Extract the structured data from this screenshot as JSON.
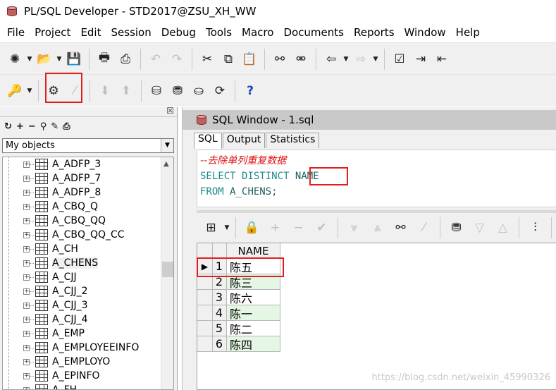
{
  "window": {
    "title": "PL/SQL Developer - STD2017@ZSU_XH_WW"
  },
  "menu": [
    "File",
    "Project",
    "Edit",
    "Session",
    "Debug",
    "Tools",
    "Macro",
    "Documents",
    "Reports",
    "Window",
    "Help"
  ],
  "object_browser": {
    "filter_value": "My objects",
    "tools": [
      "↻",
      "+",
      "−",
      "⚲",
      "✎",
      "⎙"
    ],
    "items": [
      "A_ADFP_3",
      "A_ADFP_7",
      "A_ADFP_8",
      "A_CBQ_Q",
      "A_CBQ_QQ",
      "A_CBQ_QQ_CC",
      "A_CH",
      "A_CHENS",
      "A_CJJ",
      "A_CJJ_2",
      "A_CJJ_3",
      "A_CJJ_4",
      "A_EMP",
      "A_EMPLOYEEINFO",
      "A_EMPLOYO",
      "A_EPINFO",
      "A_FH"
    ],
    "selected": "A_CHENS"
  },
  "sql_window": {
    "title": "SQL Window - 1.sql",
    "tabs": [
      "SQL",
      "Output",
      "Statistics"
    ],
    "active_tab": "SQL",
    "editor": {
      "comment": "--去除单列重复数据",
      "select_kw": "SELECT",
      "distinct_kw": "DISTINCT",
      "column": "NAME",
      "from_kw": "FROM",
      "table": "A_CHENS;"
    },
    "grid": {
      "columns": [
        "NAME"
      ],
      "rows": [
        {
          "num": "1",
          "value": "陈五"
        },
        {
          "num": "2",
          "value": "陈三"
        },
        {
          "num": "3",
          "value": "陈六"
        },
        {
          "num": "4",
          "value": "陈一"
        },
        {
          "num": "5",
          "value": "陈二"
        },
        {
          "num": "6",
          "value": "陈四"
        }
      ],
      "current_row_marker": "▶"
    }
  },
  "watermark": "https://blog.csdn.net/weixin_45990326",
  "colors": {
    "highlight_box": "#e02020",
    "comment": "#e01010",
    "keyword": "#1f8a8a",
    "row_alt": "#e4f6e4"
  }
}
